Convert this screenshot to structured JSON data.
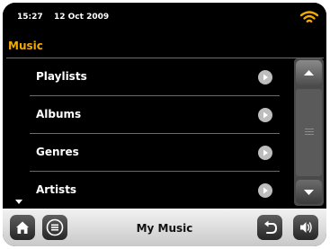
{
  "status": {
    "time": "15:27",
    "date": "12 Oct  2009"
  },
  "icons": {
    "wifi": "wifi-icon",
    "home": "home-icon",
    "menu": "menu-icon",
    "back": "back-icon",
    "volume": "volume-icon",
    "arrow": "arrow-right-icon"
  },
  "colors": {
    "accent": "#f2a900",
    "background": "#000000"
  },
  "section": {
    "title": "Music"
  },
  "list": {
    "items": [
      {
        "label": "Playlists"
      },
      {
        "label": "Albums"
      },
      {
        "label": "Genres"
      },
      {
        "label": "Artists"
      }
    ]
  },
  "toolbar": {
    "title": "My Music"
  }
}
